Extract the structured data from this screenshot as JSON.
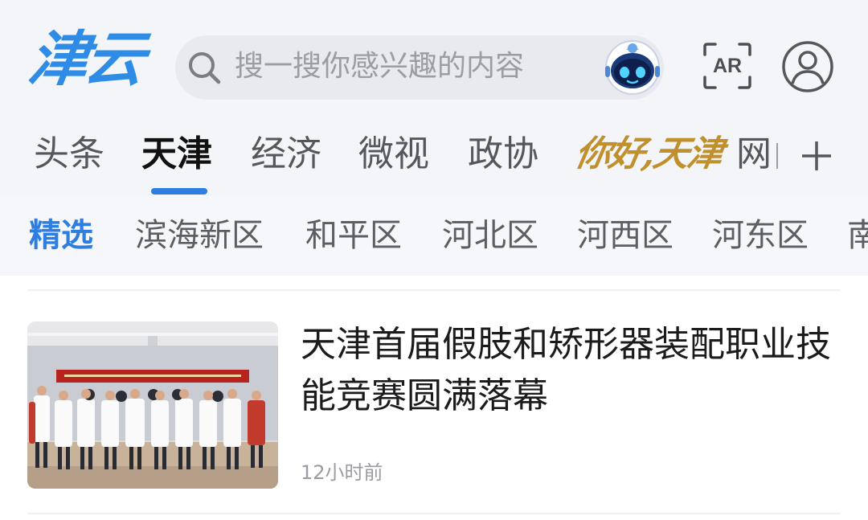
{
  "header": {
    "logo_text": "津云",
    "search_placeholder": "搜一搜你感兴趣的内容",
    "ar_label": "AR"
  },
  "tabs": [
    {
      "label": "头条"
    },
    {
      "label": "天津",
      "active": true
    },
    {
      "label": "经济"
    },
    {
      "label": "微视"
    },
    {
      "label": "政协"
    },
    {
      "label": "你好,天津"
    },
    {
      "label": "网"
    }
  ],
  "subtabs": [
    {
      "label": "精选",
      "active": true
    },
    {
      "label": "滨海新区"
    },
    {
      "label": "和平区"
    },
    {
      "label": "河北区"
    },
    {
      "label": "河西区"
    },
    {
      "label": "河东区"
    },
    {
      "label": "南"
    }
  ],
  "news": [
    {
      "title": "天津首届假肢和矫形器装配职业技能竞赛圆满落幕",
      "time": "12小时前",
      "image": "award-ceremony-group-photo"
    }
  ],
  "icons": {
    "search": "search-icon",
    "robot": "robot-assistant-icon",
    "ar": "ar-scan-icon",
    "user": "user-icon",
    "add": "plus-icon"
  },
  "colors": {
    "accent": "#2e7de1",
    "logo": "#2f8ce6",
    "special_tab": "#c0902c"
  }
}
